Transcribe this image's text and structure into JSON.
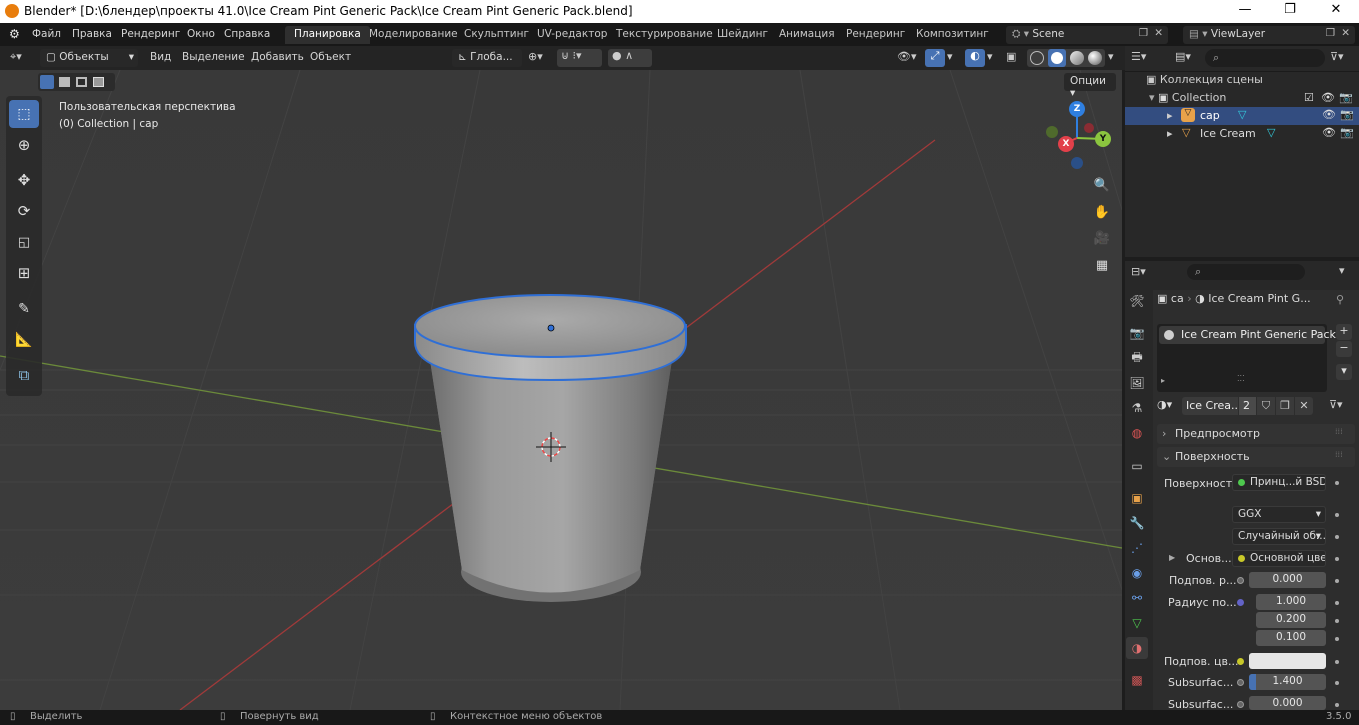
{
  "window": {
    "title": "Blender* [D:\\блендер\\проекты 41.0\\Ice Cream Pint Generic Pack\\Ice Cream Pint Generic Pack.blend]",
    "minimize": "—",
    "maximize": "❐",
    "close": "✕"
  },
  "menu": [
    "Файл",
    "Правка",
    "Рендеринг",
    "Окно",
    "Справка"
  ],
  "workspaces": {
    "active": "Планировка",
    "tabs": [
      "Моделирование",
      "Скульптинг",
      "UV-редактор",
      "Текстурирование",
      "Шейдинг",
      "Анимация",
      "Рендеринг",
      "Композитинг"
    ]
  },
  "scene": {
    "name": "Scene",
    "view_layer": "ViewLayer"
  },
  "viewport_header": {
    "mode": "Объекты",
    "menus": [
      "Вид",
      "Выделение",
      "Добавить",
      "Объект"
    ],
    "transform_orientation": "Глоба...",
    "options": "Опции"
  },
  "viewport": {
    "view_name": "Пользовательская перспектива",
    "context": "(0) Collection | cap",
    "gizmo": {
      "x": "X",
      "y": "Y",
      "z": "Z"
    }
  },
  "outliner": {
    "scene_collection": "Коллекция сцены",
    "collection": "Collection",
    "objects": [
      {
        "name": "cap",
        "selected": true
      },
      {
        "name": "Ice Cream",
        "selected": false
      }
    ]
  },
  "properties": {
    "breadcrumb_object": "ca",
    "breadcrumb_material": "Ice Cream Pint G...",
    "material_slot": "Ice Cream Pint Generic Pack",
    "material_name": "Ice Crea...",
    "users": "2",
    "panels": {
      "preview": "Предпросмотр",
      "surface": "Поверхность"
    },
    "surface": {
      "label": "Поверхность",
      "shader": "Принц...й BSDF",
      "distribution": "GGX",
      "subsurface_method": "Случайный об...",
      "base_color_label": "Основ...",
      "base_color_value": "Основной цвет",
      "subsurface_label": "Подпов. р...",
      "subsurface_value": "0.000",
      "radius_label": "Радиус по...",
      "radius": [
        "1.000",
        "0.200",
        "0.100"
      ],
      "subsurface_color_label": "Подпов. цв...",
      "subsurface_ior_label": "Subsurfac...",
      "subsurface_ior": "1.400",
      "subsurface_aniso_label": "Subsurfac...",
      "subsurface_aniso": "0.000"
    }
  },
  "status": {
    "select": "Выделить",
    "rotate": "Повернуть вид",
    "context_menu": "Контекстное меню объектов",
    "version": "3.5.0"
  },
  "colors": {
    "accent": "#4772b3",
    "x_axis": "#e2404a",
    "y_axis": "#8bc53f",
    "z_axis": "#2f7fe0",
    "selection_outline": "#2f6fd6",
    "viewport_bg": "#393939"
  }
}
